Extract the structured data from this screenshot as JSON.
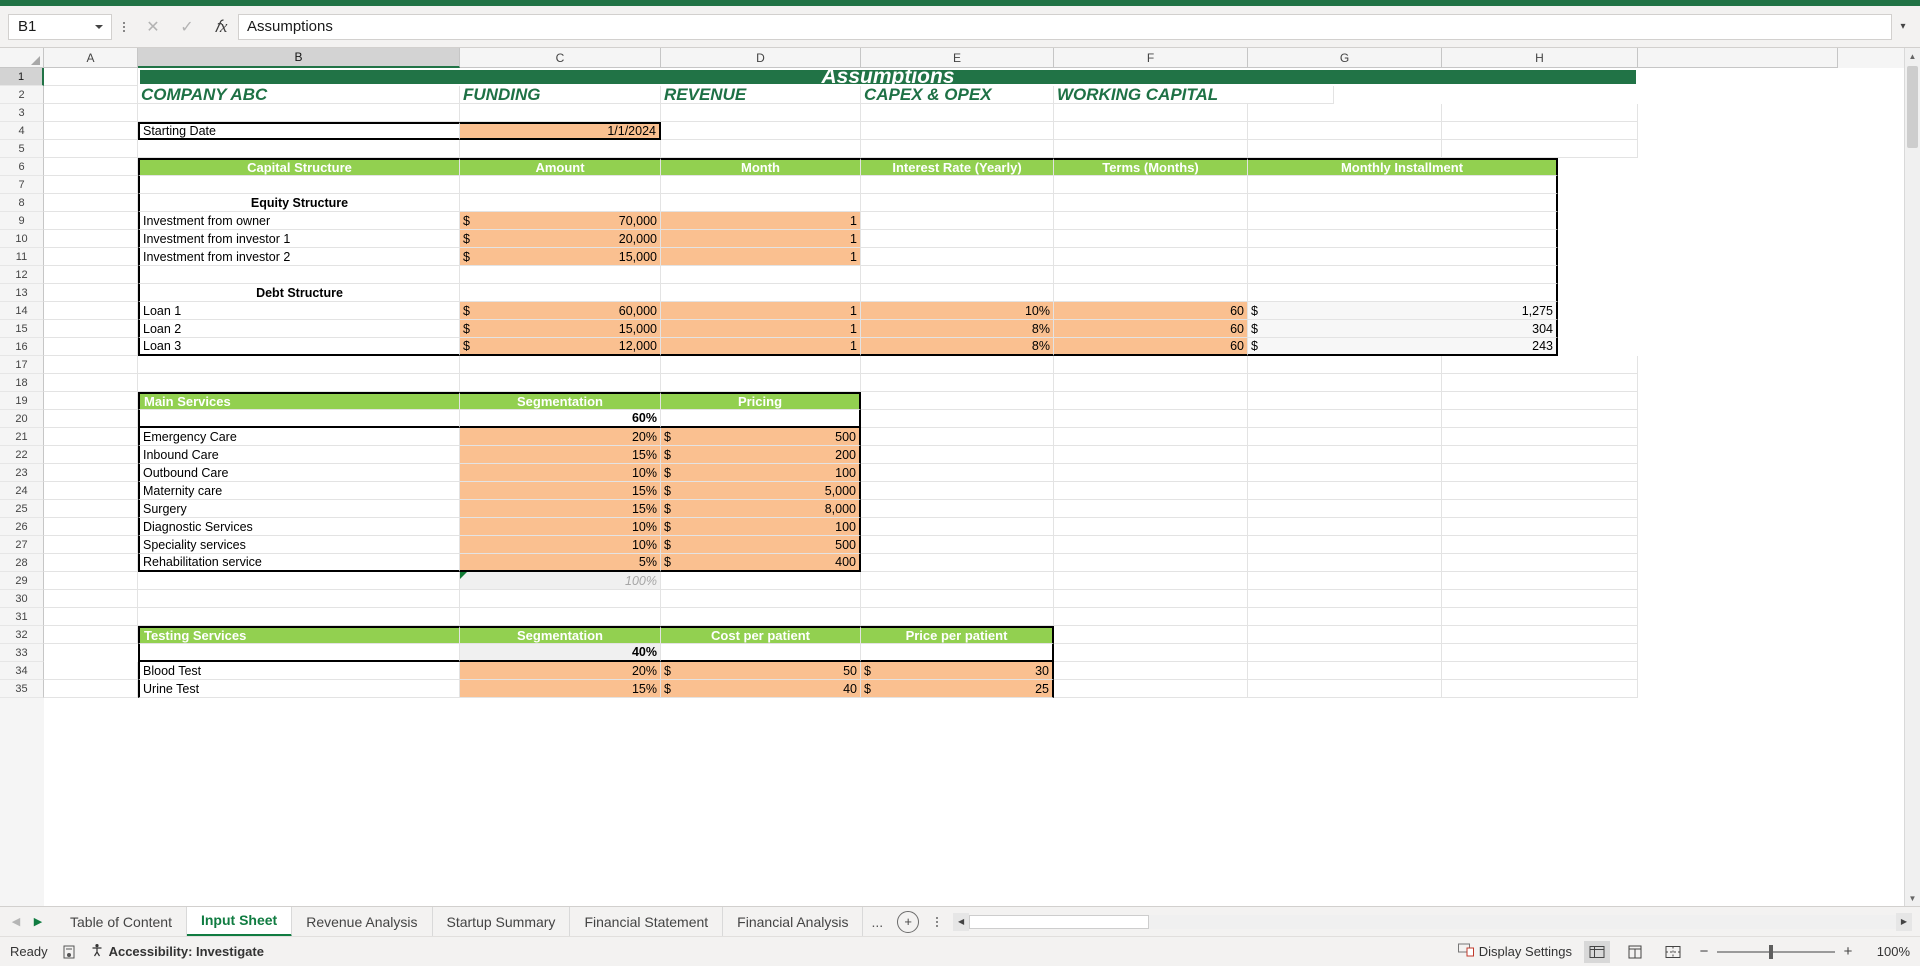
{
  "formula_bar": {
    "name_box_value": "B1",
    "formula_value": "Assumptions",
    "cancel_icon": "close-icon",
    "confirm_icon": "check-icon",
    "function_icon": "fx-icon",
    "expand_icon": "chevron-down-icon"
  },
  "columns": [
    "A",
    "B",
    "C",
    "D",
    "E",
    "F",
    "G",
    "H"
  ],
  "selected_column": "B",
  "row_numbers": [
    "1",
    "2",
    "3",
    "4",
    "5",
    "6",
    "7",
    "8",
    "9",
    "10",
    "11",
    "12",
    "13",
    "14",
    "15",
    "16",
    "17",
    "18",
    "19",
    "20",
    "21",
    "22",
    "23",
    "24",
    "25",
    "26",
    "27",
    "28",
    "29",
    "30",
    "31",
    "32",
    "33",
    "34",
    "35"
  ],
  "selected_row": "1",
  "sheet": {
    "title": "Assumptions",
    "nav_links": [
      "COMPANY ABC",
      "FUNDING",
      "REVENUE",
      "CAPEX & OPEX",
      "WORKING CAPITAL"
    ],
    "starting_date": {
      "label": "Starting Date",
      "value": "1/1/2024"
    },
    "capital_structure": {
      "headers": [
        "Capital Structure",
        "Amount",
        "Month",
        "Interest Rate (Yearly)",
        "Terms (Months)",
        "Monthly Installment"
      ],
      "equity_title": "Equity Structure",
      "equity_rows": [
        {
          "label": "Investment from owner",
          "currency": "$",
          "amount": "70,000",
          "month": "1"
        },
        {
          "label": "Investment from investor 1",
          "currency": "$",
          "amount": "20,000",
          "month": "1"
        },
        {
          "label": "Investment from investor 2",
          "currency": "$",
          "amount": "15,000",
          "month": "1"
        }
      ],
      "debt_title": "Debt Structure",
      "debt_rows": [
        {
          "label": "Loan 1",
          "currency": "$",
          "amount": "60,000",
          "month": "1",
          "rate": "10%",
          "terms": "60",
          "inst_currency": "$",
          "installment": "1,275"
        },
        {
          "label": "Loan 2",
          "currency": "$",
          "amount": "15,000",
          "month": "1",
          "rate": "8%",
          "terms": "60",
          "inst_currency": "$",
          "installment": "304"
        },
        {
          "label": "Loan 3",
          "currency": "$",
          "amount": "12,000",
          "month": "1",
          "rate": "8%",
          "terms": "60",
          "inst_currency": "$",
          "installment": "243"
        }
      ]
    },
    "main_services": {
      "headers": [
        "Main Services",
        "Segmentation",
        "Pricing"
      ],
      "group_share": "60%",
      "rows": [
        {
          "label": "Emergency Care",
          "segmentation": "20%",
          "currency": "$",
          "price": "500"
        },
        {
          "label": "Inbound Care",
          "segmentation": "15%",
          "currency": "$",
          "price": "200"
        },
        {
          "label": "Outbound Care",
          "segmentation": "10%",
          "currency": "$",
          "price": "100"
        },
        {
          "label": "Maternity care",
          "segmentation": "15%",
          "currency": "$",
          "price": "5,000"
        },
        {
          "label": "Surgery",
          "segmentation": "15%",
          "currency": "$",
          "price": "8,000"
        },
        {
          "label": "Diagnostic Services",
          "segmentation": "10%",
          "currency": "$",
          "price": "100"
        },
        {
          "label": "Speciality services",
          "segmentation": "10%",
          "currency": "$",
          "price": "500"
        },
        {
          "label": "Rehabilitation service",
          "segmentation": "5%",
          "currency": "$",
          "price": "400"
        }
      ],
      "total": "100%"
    },
    "testing_services": {
      "headers": [
        "Testing Services",
        "Segmentation",
        "Cost per patient",
        "Price per patient"
      ],
      "group_share": "40%",
      "rows": [
        {
          "label": "Blood Test",
          "segmentation": "20%",
          "cost_currency": "$",
          "cost": "50",
          "price_currency": "$",
          "price": "30"
        },
        {
          "label": "Urine Test",
          "segmentation": "15%",
          "cost_currency": "$",
          "cost": "40",
          "price_currency": "$",
          "price": "25"
        }
      ]
    }
  },
  "tabs": {
    "prev_icon": "chevron-left-icon",
    "next_icon": "chevron-right-icon",
    "items": [
      "Table of Content",
      "Input Sheet",
      "Revenue Analysis",
      "Startup Summary",
      "Financial Statement",
      "Financial Analysis"
    ],
    "active": "Input Sheet",
    "overflow_label": "...",
    "add_sheet_icon": "plus-icon",
    "more_icon": "kebab-icon"
  },
  "status_bar": {
    "state": "Ready",
    "macro_icon": "record-macro-icon",
    "accessibility_icon": "accessibility-icon",
    "accessibility_label": "Accessibility: Investigate",
    "display_settings_icon": "display-settings-icon",
    "display_settings_label": "Display Settings",
    "view_normal_icon": "normal-view-icon",
    "view_pagelayout_icon": "page-layout-icon",
    "view_pagebreak_icon": "page-break-view-icon",
    "zoom_out": "−",
    "zoom_in": "+",
    "zoom_level": "100%"
  },
  "colors": {
    "excel_green": "#217346",
    "header_green": "#92d050",
    "input_orange": "#fac090",
    "nav_link_green": "#1e7145"
  }
}
